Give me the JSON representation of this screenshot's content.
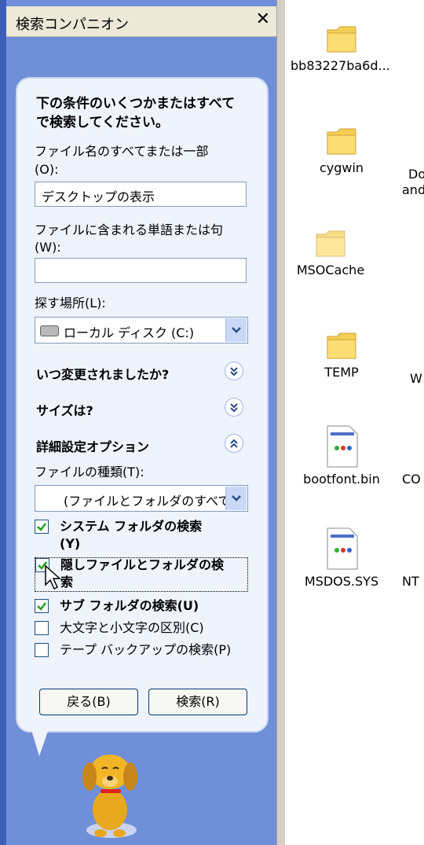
{
  "companion": {
    "title": "検索コンパニオン",
    "heading": "下の条件のいくつかまたはすべてで検索してください。",
    "filename_label": "ファイル名のすべてまたは一部",
    "filename_label_key": "(O):",
    "filename_value": "デスクトップの表示",
    "words_label": "ファイルに含まれる単語または句",
    "words_label_key": "(W):",
    "words_value": "",
    "lookin_label": "探す場所(L):",
    "lookin_value": "ローカル ディスク (C:)",
    "section_modified": "いつ変更されましたか?",
    "section_size": "サイズは?",
    "section_advanced": "詳細設定オプション",
    "filetype_label": "ファイルの種類(T):",
    "filetype_value": "(ファイルとフォルダのすべて",
    "options": [
      {
        "label_line1": "システム フォルダの検索",
        "label_line2": "(Y)",
        "checked": true,
        "bold": true
      },
      {
        "label_line1": "隠しファイルとフォルダの検",
        "label_line2": "索",
        "checked": true,
        "bold": true
      },
      {
        "label_line1": "サブ フォルダの検索(U)",
        "checked": true,
        "bold": true
      },
      {
        "label_line1": "大文字と小文字の区別(C)",
        "checked": false,
        "bold": false
      },
      {
        "label_line1": "テープ バックアップの検索(P)",
        "checked": false,
        "bold": false
      }
    ],
    "back_button": "戻る(B)",
    "search_button": "検索(R)"
  },
  "files": [
    {
      "name": "bb83227ba6d...",
      "icon": "folder-icon"
    },
    {
      "name": "cygwin",
      "icon": "folder-icon"
    },
    {
      "name": "MSOCache",
      "icon": "folder-icon"
    },
    {
      "name": "TEMP",
      "icon": "folder-icon"
    },
    {
      "name": "bootfont.bin",
      "icon": "file-icon"
    },
    {
      "name": "MSDOS.SYS",
      "icon": "file-icon"
    }
  ],
  "clipped_files": [
    {
      "line1": "Do",
      "line2": "and"
    },
    {
      "line1": "W"
    },
    {
      "line1": "CO"
    },
    {
      "line1": "NT"
    }
  ],
  "colors": {
    "pane": "#6f8fd8",
    "bubble": "#eff3fc",
    "folder": "#f5cf55"
  }
}
